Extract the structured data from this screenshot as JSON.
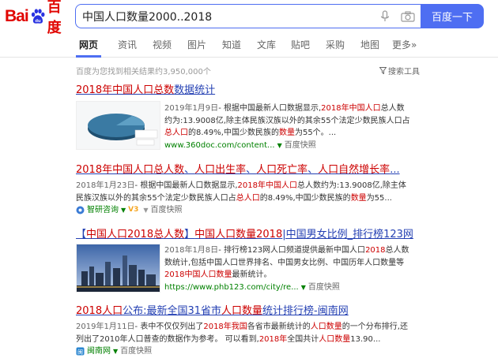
{
  "logo": {
    "bai": "Bai",
    "du": "百度"
  },
  "search": {
    "query": "中国人口数量2000..2018",
    "button": "百度一下"
  },
  "nav": [
    {
      "label": "网页",
      "active": true
    },
    {
      "label": "资讯"
    },
    {
      "label": "视频"
    },
    {
      "label": "图片"
    },
    {
      "label": "知道"
    },
    {
      "label": "文库"
    },
    {
      "label": "贴吧"
    },
    {
      "label": "采购"
    },
    {
      "label": "地图"
    },
    {
      "label": "更多»"
    }
  ],
  "meta": "百度为您找到相关结果约3,950,000个",
  "tools": "搜索工具",
  "results": [
    {
      "title_parts": [
        "2018年中国人口总数",
        "数据统计"
      ],
      "date": "2019年1月9日",
      "lines": [
        [
          "- 根据中国最新人口数据显示,",
          "2018年",
          "中国人口",
          "总人数"
        ],
        [
          "约为:13.9008亿,除主体民族汉族以外的其余55个法定少数民族人口占"
        ],
        [
          "",
          "总人口",
          "的8.49%,中国少数民族的",
          "数量",
          "为55个。..."
        ]
      ],
      "source": "www.360doc.com/content...",
      "snapshot": "百度快照"
    },
    {
      "title_parts": [
        "2018年中国人口总人数",
        "、",
        "人口出生率",
        "、",
        "人口死亡率",
        "、",
        "人口自然增长率",
        "..."
      ],
      "date": "2018年1月23日",
      "lines": [
        [
          "- 根据中国最新人口数据显示,",
          "2018年",
          "中国人口",
          "总人数约为:13.9008亿,除主体"
        ],
        [
          "民族汉族以外的其余55个法定少数民族人口占",
          "总人口",
          "的8.49%,中国少数民族的",
          "数量",
          "为55..."
        ]
      ],
      "source": "智研咨询",
      "snapshot": "百度快照"
    },
    {
      "title_parts": [
        "【",
        "中国人口2018总人数",
        "】",
        "中国人口数量2018",
        "|中国男女比例_排行榜123网"
      ],
      "date": "2018年1月8日",
      "lines": [
        [
          "- 排行榜123网人口频道提供最新中国人口",
          "2018",
          "总人数"
        ],
        [
          "数统计,包括中国人口世界排名、中国男女比例、中国历年人口数量等"
        ],
        [
          "",
          "2018中国人口数量",
          "最新统计。"
        ]
      ],
      "source": "https://www.phb123.com/city/re...",
      "snapshot": "百度快照"
    },
    {
      "title_parts": [
        "2018人口",
        "公布:最新全国31省市",
        "人口数量",
        "统计排行榜-闽南网"
      ],
      "date": "2019年1月11日",
      "lines": [
        [
          "- 表中不仅仅列出了",
          "2018年",
          "我国",
          "各省市最新统计的",
          "人口数量",
          "的一个分布排行,还"
        ],
        [
          "列出了2010年人口普查的数据作为参考。 可以看到,",
          "2018年",
          "全国共计",
          "人口数量",
          "13.90..."
        ]
      ],
      "source": "闽南网",
      "snapshot": "百度快照"
    }
  ]
}
